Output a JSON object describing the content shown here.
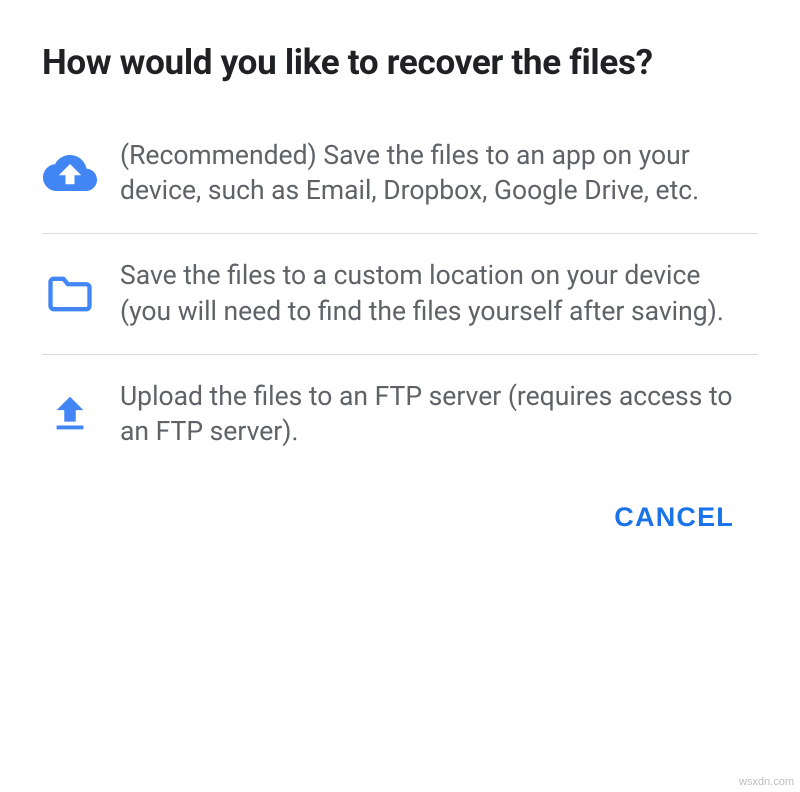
{
  "dialog": {
    "title": "How would you like to recover the files?",
    "options": [
      {
        "icon": "cloud-upload-icon",
        "text": "(Recommended) Save the files to an app on your device, such as Email, Dropbox, Google Drive, etc."
      },
      {
        "icon": "folder-icon",
        "text": "Save the files to a custom location on your device (you will need to find the files yourself after saving)."
      },
      {
        "icon": "upload-arrow-icon",
        "text": "Upload the files to an FTP server (requires access to an FTP server)."
      }
    ],
    "cancel_label": "CANCEL"
  },
  "colors": {
    "accent": "#4285F4",
    "text_primary": "#202124",
    "text_secondary": "#5f6368"
  },
  "watermark": "wsxdn.com"
}
